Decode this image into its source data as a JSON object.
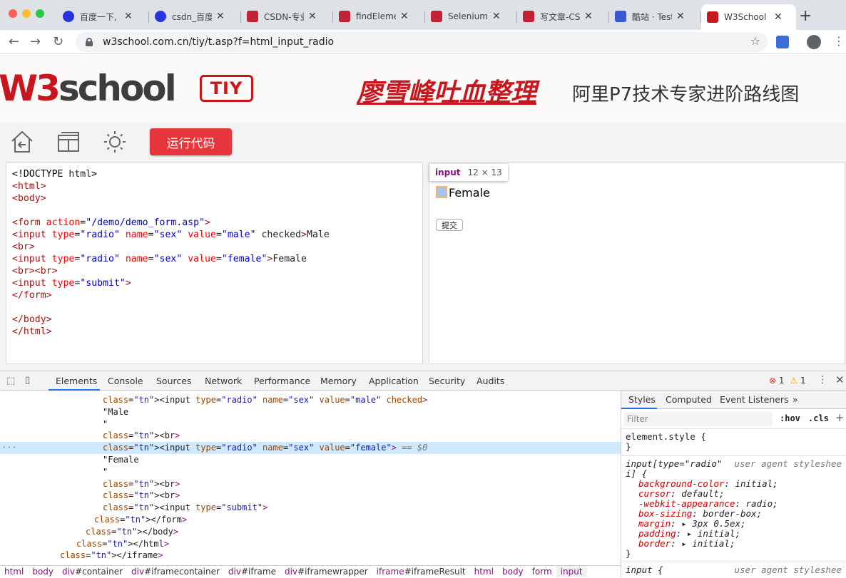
{
  "browser": {
    "tabs": [
      {
        "title": "百度一下, 你",
        "favicon": "baidu-paw-icon",
        "color": "#2932e1"
      },
      {
        "title": "csdn_百度搜",
        "favicon": "baidu-paw-icon",
        "color": "#2932e1"
      },
      {
        "title": "CSDN-专业IT",
        "favicon": "csdn-c-icon",
        "color": "#c32136"
      },
      {
        "title": "findElement",
        "favicon": "csdn-c-icon",
        "color": "#c32136"
      },
      {
        "title": "SeleniumW",
        "favicon": "csdn-c-icon",
        "color": "#c32136"
      },
      {
        "title": "写文章-CSDN",
        "favicon": "csdn-c-icon",
        "color": "#c32136"
      },
      {
        "title": "酷站 · Teste",
        "favicon": "shield-icon",
        "color": "#3a58d6"
      },
      {
        "title": "W3School",
        "favicon": "w3school-icon",
        "color": "#c7161d",
        "active": true
      }
    ],
    "new_tab": "+",
    "url": "w3school.com.cn/tiy/t.asp?f=html_input_radio"
  },
  "site": {
    "logo_w3": "W3",
    "logo_school": "school",
    "tiy": "TIY",
    "promo_red": "廖雪峰吐血整理",
    "promo_black": "阿里P7技术专家进阶路线图",
    "run_button": "运行代码"
  },
  "code": {
    "lines": [
      "<!DOCTYPE html>",
      "<html>",
      "<body>",
      "",
      "<form action=\"/demo/demo_form.asp\">",
      "<input type=\"radio\" name=\"sex\" value=\"male\" checked>Male",
      "<br>",
      "<input type=\"radio\" name=\"sex\" value=\"female\">Female",
      "<br><br>",
      "<input type=\"submit\">",
      "</form>",
      "",
      "</body>",
      "</html>"
    ]
  },
  "result": {
    "tooltip_name": "input",
    "tooltip_dims": "12 × 13",
    "female_label": "Female",
    "submit_label": "提交"
  },
  "devtools": {
    "tabs": [
      "Elements",
      "Console",
      "Sources",
      "Network",
      "Performance",
      "Memory",
      "Application",
      "Security",
      "Audits"
    ],
    "errors": "1",
    "warnings": "1",
    "dom_lines": [
      {
        "indent": 144,
        "html": "<input type=\"radio\" name=\"sex\" value=\"male\" checked>"
      },
      {
        "indent": 144,
        "html": "\"Male"
      },
      {
        "indent": 144,
        "html": "\""
      },
      {
        "indent": 144,
        "html": "<br>"
      },
      {
        "indent": 144,
        "html": "<input type=\"radio\" name=\"sex\" value=\"female\"> == $0",
        "selected": true
      },
      {
        "indent": 144,
        "html": "\"Female"
      },
      {
        "indent": 144,
        "html": "\""
      },
      {
        "indent": 144,
        "html": "<br>"
      },
      {
        "indent": 144,
        "html": "<br>"
      },
      {
        "indent": 144,
        "html": "<input type=\"submit\">"
      },
      {
        "indent": 132,
        "html": "</form>"
      },
      {
        "indent": 120,
        "html": "</body>"
      },
      {
        "indent": 107,
        "html": "</html>"
      },
      {
        "indent": 84,
        "html": "</iframe>"
      }
    ],
    "breadcrumb": [
      {
        "t": "html",
        "h": ""
      },
      {
        "t": "body",
        "h": ""
      },
      {
        "t": "div",
        "h": "#container"
      },
      {
        "t": "div",
        "h": "#iframecontainer"
      },
      {
        "t": "div",
        "h": "#iframe"
      },
      {
        "t": "div",
        "h": "#iframewrapper"
      },
      {
        "t": "iframe",
        "h": "#iframeResult"
      },
      {
        "t": "html",
        "h": ""
      },
      {
        "t": "body",
        "h": ""
      },
      {
        "t": "form",
        "h": ""
      },
      {
        "t": "input",
        "h": ""
      }
    ],
    "styles_tabs": [
      "Styles",
      "Computed",
      "Event Listeners",
      "»"
    ],
    "filter_placeholder": "Filter",
    "hov": ":hov",
    "cls": ".cls",
    "element_style": "element.style {",
    "close_brace": "}",
    "ua_selector": "input[type=\"radio\"",
    "ua_selector2": "i] {",
    "ua_label": "user agent styleshee",
    "ua_props": [
      {
        "p": "background-color",
        "v": "initial;"
      },
      {
        "p": "cursor",
        "v": "default;"
      },
      {
        "p": "-webkit-appearance",
        "v": "radio;"
      },
      {
        "p": "box-sizing",
        "v": "border-box;"
      },
      {
        "p": "margin",
        "v": "▸ 3px 0.5ex;"
      },
      {
        "p": "padding",
        "v": "▸ initial;"
      },
      {
        "p": "border",
        "v": "▸ initial;"
      }
    ],
    "input_rule": "input {"
  }
}
